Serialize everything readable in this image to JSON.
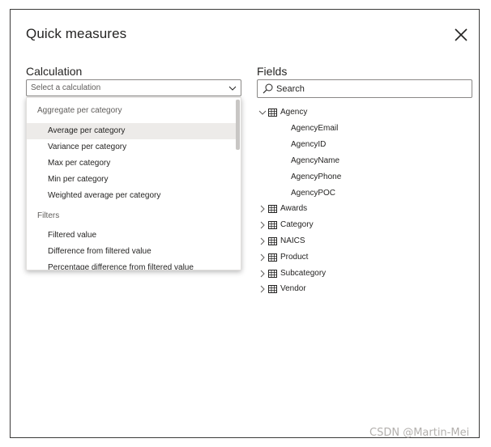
{
  "dialog": {
    "title": "Quick measures"
  },
  "calculation": {
    "label": "Calculation",
    "select_placeholder": "Select a calculation",
    "groups": [
      {
        "name": "Aggregate per category",
        "items": [
          "Average per category",
          "Variance per category",
          "Max per category",
          "Min per category",
          "Weighted average per category"
        ]
      },
      {
        "name": "Filters",
        "items": [
          "Filtered value",
          "Difference from filtered value",
          "Percentage difference from filtered value"
        ]
      }
    ],
    "hovered_item": "Average per category"
  },
  "fields": {
    "label": "Fields",
    "search_placeholder": "Search",
    "tables": [
      {
        "name": "Agency",
        "expanded": true,
        "fields": [
          "AgencyEmail",
          "AgencyID",
          "AgencyName",
          "AgencyPhone",
          "AgencyPOC"
        ]
      },
      {
        "name": "Awards",
        "expanded": false
      },
      {
        "name": "Category",
        "expanded": false
      },
      {
        "name": "NAICS",
        "expanded": false
      },
      {
        "name": "Product",
        "expanded": false
      },
      {
        "name": "Subcategory",
        "expanded": false
      },
      {
        "name": "Vendor",
        "expanded": false
      }
    ]
  },
  "watermark": "CSDN @Martin-Mei",
  "icons": {
    "close": "close-icon",
    "chevron": "chevron-down-icon",
    "search": "search-icon",
    "table": "table-icon"
  },
  "colors": {
    "border": "#3b3a39",
    "hover": "#edebe9",
    "muted": "#605e5c"
  }
}
